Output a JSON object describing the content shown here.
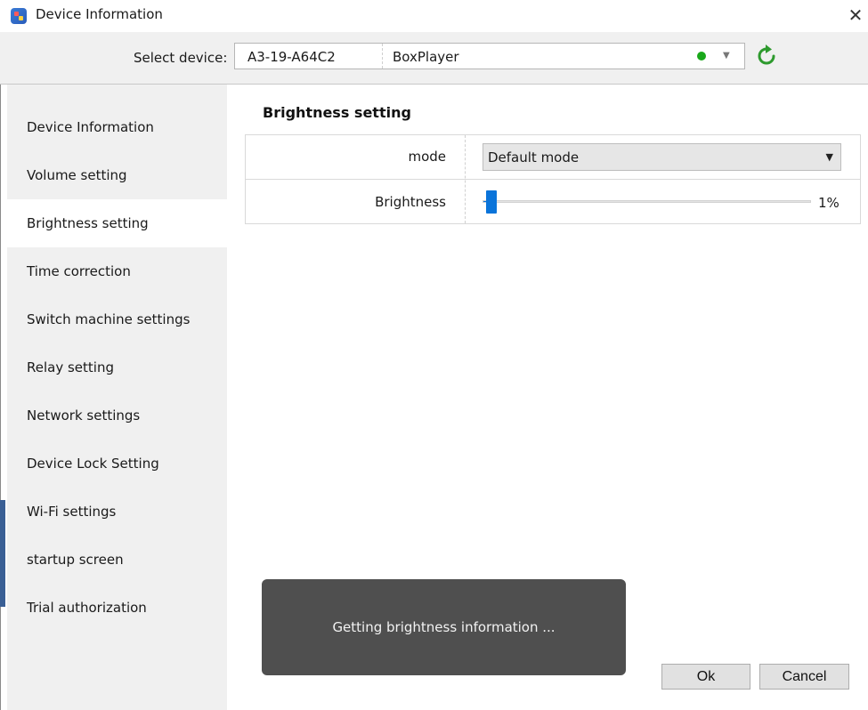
{
  "window": {
    "title": "Device Information",
    "close_glyph": "✕"
  },
  "device_bar": {
    "label": "Select device:",
    "selected_id": "A3-19-A64C2",
    "selected_name": "BoxPlayer",
    "status_color": "#19a81a",
    "dropdown_glyph": "▼",
    "refresh_icon": "refresh-icon"
  },
  "sidebar": {
    "active_index": 2,
    "items": [
      {
        "label": "Device Information"
      },
      {
        "label": "Volume setting"
      },
      {
        "label": "Brightness setting"
      },
      {
        "label": "Time correction"
      },
      {
        "label": "Switch machine settings"
      },
      {
        "label": "Relay setting"
      },
      {
        "label": "Network settings"
      },
      {
        "label": "Device Lock Setting"
      },
      {
        "label": "Wi-Fi settings"
      },
      {
        "label": "startup screen"
      },
      {
        "label": "Trial authorization"
      }
    ]
  },
  "brightness": {
    "section_title": "Brightness setting",
    "mode_label": "mode",
    "mode_value": "Default mode",
    "mode_dropdown_glyph": "▼",
    "brightness_label": "Brightness",
    "brightness_value": 1,
    "brightness_text": "1%",
    "accent_color": "#0a74da"
  },
  "toast": {
    "message": "Getting brightness information ..."
  },
  "buttons": {
    "ok": "Ok",
    "cancel": "Cancel"
  }
}
